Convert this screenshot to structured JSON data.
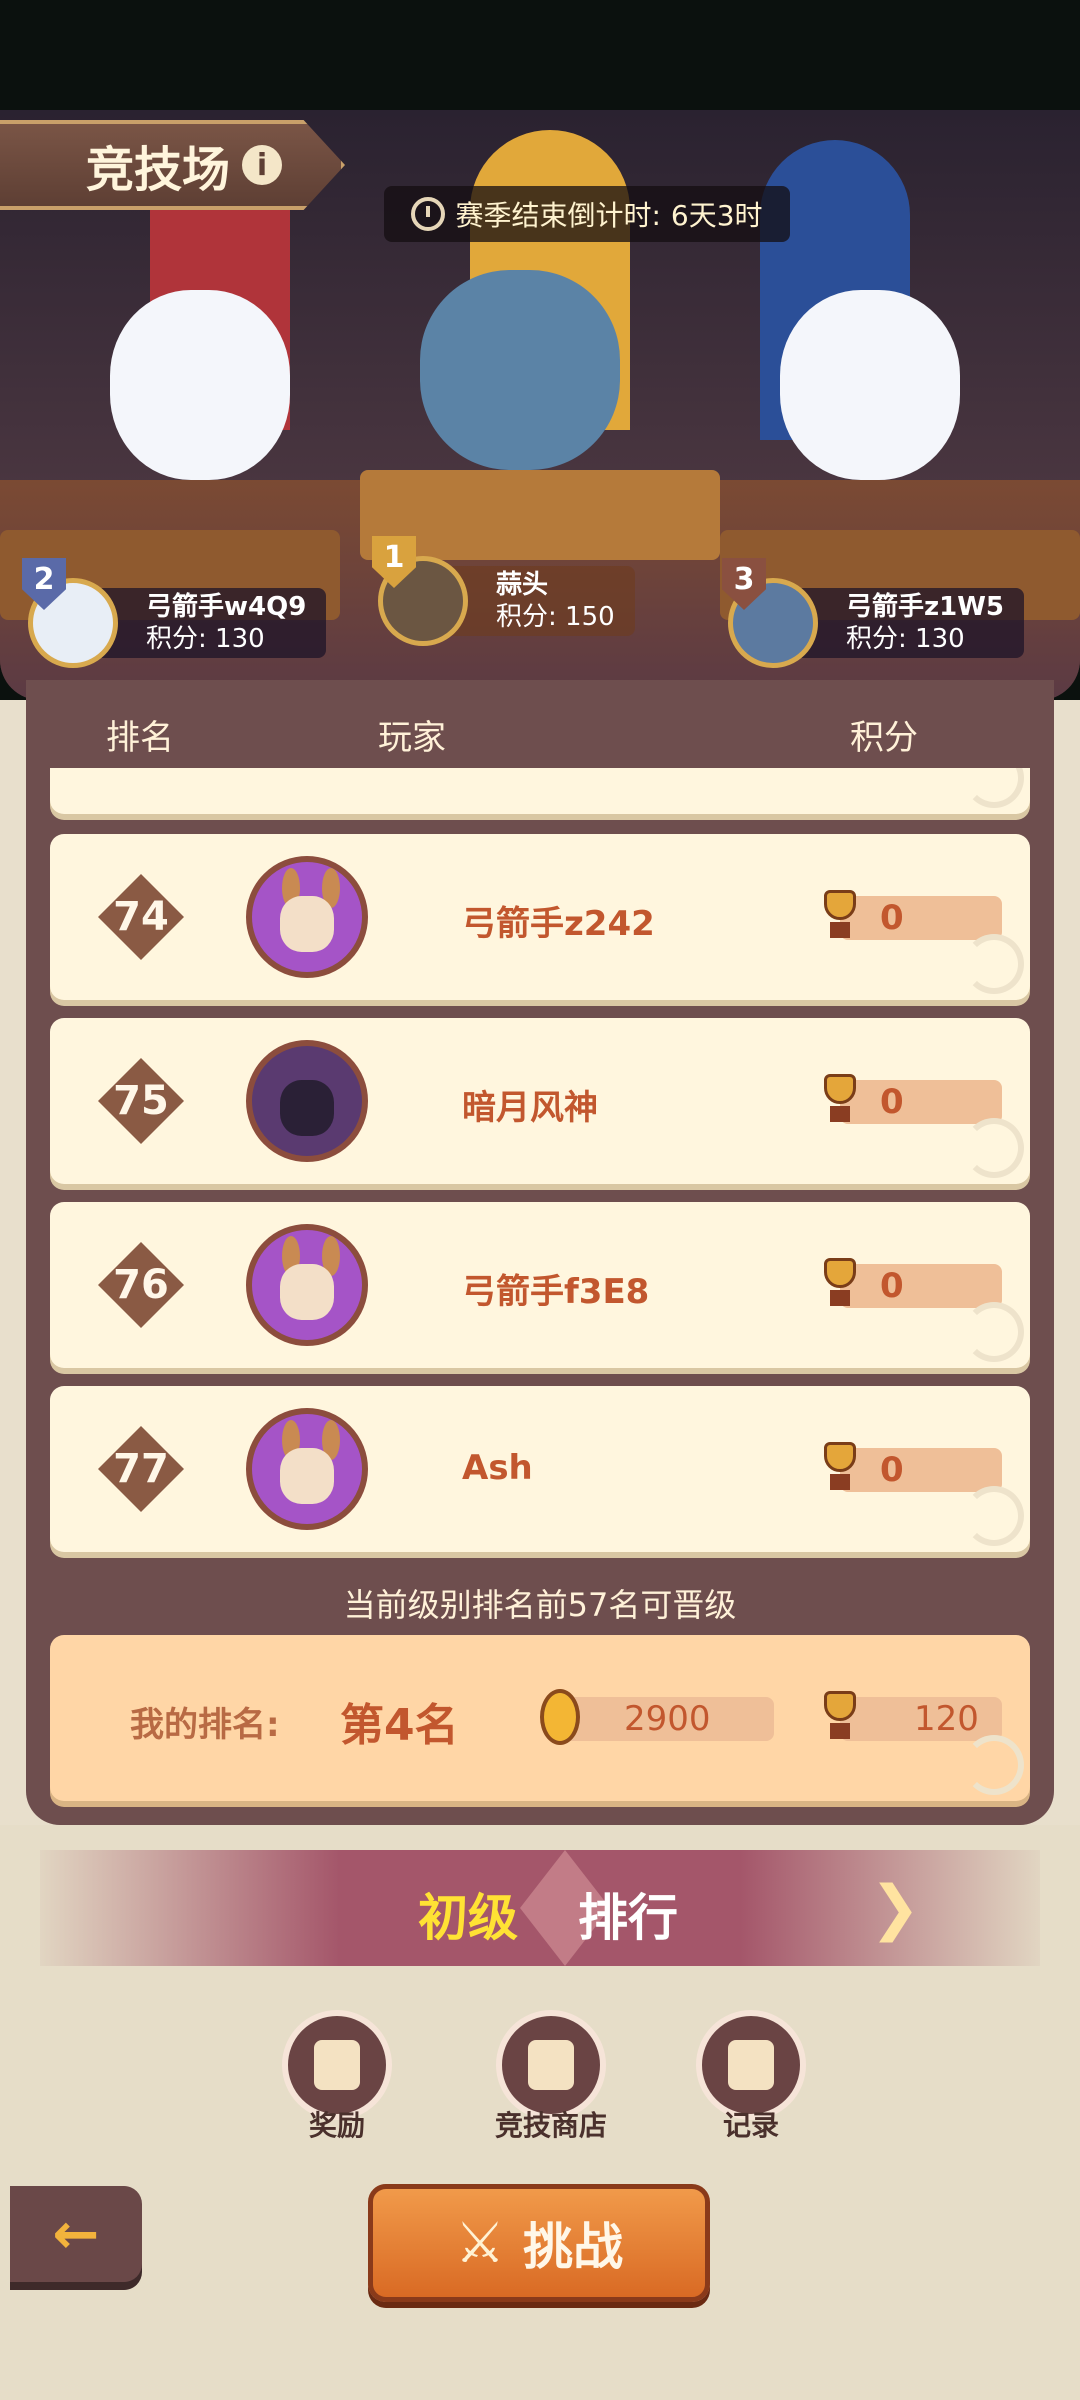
{
  "header": {
    "title": "竞技场",
    "info_icon": "info-icon",
    "countdown_label": "赛季结束倒计时:",
    "countdown_value": "6天3时"
  },
  "podium": [
    {
      "rank": "2",
      "name": "弓箭手w4Q9",
      "score_label": "积分:",
      "score": "130",
      "shield_color": "#5a6aa8"
    },
    {
      "rank": "1",
      "name": "蒜头",
      "score_label": "积分:",
      "score": "150",
      "shield_color": "#d9a23e"
    },
    {
      "rank": "3",
      "name": "弓箭手z1W5",
      "score_label": "积分:",
      "score": "130",
      "shield_color": "#8a5040"
    }
  ],
  "leaderboard": {
    "columns": [
      "排名",
      "玩家",
      "积分"
    ],
    "rows": [
      {
        "rank": "74",
        "name": "弓箭手z242",
        "score": "0",
        "avatar": "rabbit-goggles-avatar"
      },
      {
        "rank": "75",
        "name": "暗月风神",
        "score": "0",
        "avatar": "hooded-mage-avatar"
      },
      {
        "rank": "76",
        "name": "弓箭手f3E8",
        "score": "0",
        "avatar": "rabbit-goggles-avatar"
      },
      {
        "rank": "77",
        "name": "Ash",
        "score": "0",
        "avatar": "rabbit-goggles-avatar"
      }
    ],
    "promotion_note": "当前级别排名前57名可晋级",
    "my_rank": {
      "label": "我的排名:",
      "rank": "第4名",
      "coins": "2900",
      "score": "120"
    }
  },
  "tier": {
    "level": "初级",
    "label": "排行",
    "next_icon": "chevron-right-icon"
  },
  "actions": [
    {
      "label": "奖励",
      "icon": "gift-icon"
    },
    {
      "label": "竞技商店",
      "icon": "shop-bag-icon"
    },
    {
      "label": "记录",
      "icon": "clipboard-icon"
    }
  ],
  "challenge_label": "挑战",
  "colors": {
    "accent_orange": "#d96a24",
    "panel_brown": "#6e4e4e",
    "row_cream": "#fff6de",
    "name_red": "#c2572e",
    "tier_yellow": "#ffe234"
  }
}
